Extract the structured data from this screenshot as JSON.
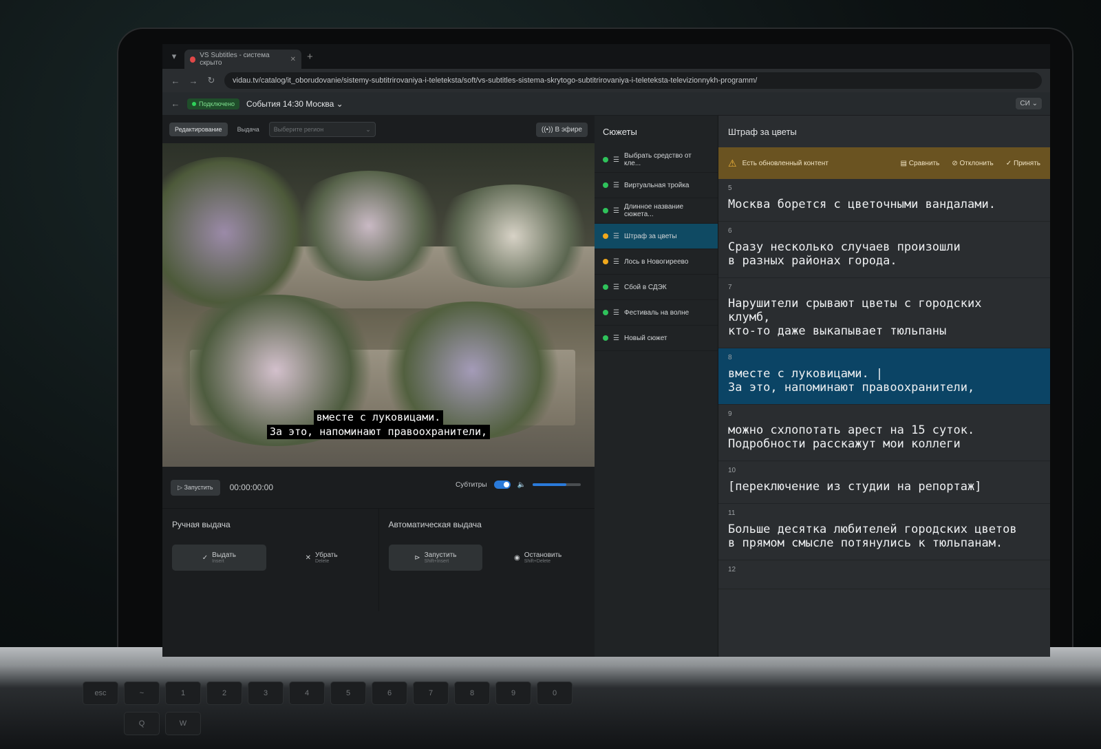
{
  "browser": {
    "tab_title": "VS Subtitles - система скрыто",
    "url": "vidau.tv/catalog/it_oborudovanie/sistemy-subtitrirovaniya-i-teleteksta/soft/vs-subtitles-sistema-skrytogo-subtitrirovaniya-i-teleteksta-televizionnykh-programm/"
  },
  "header": {
    "status_badge": "Подключено",
    "event_title": "События 14:30 Москва",
    "user_initials": "СИ"
  },
  "toolbar": {
    "mode_edit": "Редактирование",
    "mode_issue": "Выдача",
    "region_placeholder": "Выберите регион",
    "on_air": "В эфире"
  },
  "player": {
    "caption_line1": "вместе с луковицами.",
    "caption_line2": "За это, напоминают правоохранители,",
    "play_label": "Запустить",
    "timecode": "00:00:00:00",
    "subtitles_label": "Субтитры",
    "volume_level": 0.7
  },
  "manual": {
    "title": "Ручная выдача",
    "issue_label": "Выдать",
    "issue_hint": "Insert",
    "remove_label": "Убрать",
    "remove_hint": "Delete"
  },
  "auto": {
    "title": "Автоматическая выдача",
    "start_label": "Запустить",
    "start_hint": "Shift+Insert",
    "stop_label": "Остановить",
    "stop_hint": "Shift+Delete"
  },
  "stories": {
    "title": "Сюжеты",
    "items": [
      {
        "label": "Выбрать средство от кле...",
        "status_color": "#2fc25b"
      },
      {
        "label": "Виртуальная тройка",
        "status_color": "#2fc25b"
      },
      {
        "label": "Длинное название сюжета...",
        "status_color": "#2fc25b"
      },
      {
        "label": "Штраф за цветы",
        "status_color": "#f0a81c"
      },
      {
        "label": "Лось в Новогиреево",
        "status_color": "#f0a81c"
      },
      {
        "label": "Сбой в СДЭК",
        "status_color": "#2fc25b"
      },
      {
        "label": "Фестиваль на волне",
        "status_color": "#2fc25b"
      },
      {
        "label": "Новый сюжет",
        "status_color": "#2fc25b"
      }
    ]
  },
  "editor": {
    "title": "Штраф за цветы",
    "notice": "Есть обновленный контент",
    "compare": "Сравнить",
    "reject": "Отклонить",
    "accept": "Принять",
    "cues": [
      {
        "num": "5",
        "text": "Москва борется с цветочными вандалами."
      },
      {
        "num": "6",
        "text": "Сразу несколько случаев произошли\nв разных районах города."
      },
      {
        "num": "7",
        "text": "Нарушители срывают цветы с городских\nклумб,\nкто-то даже выкапывает тюльпаны"
      },
      {
        "num": "8",
        "text": "вместе с луковицами. |\nЗа это, напоминают правоохранители,"
      },
      {
        "num": "9",
        "text": "можно схлопотать арест на 15 суток.\nПодробности расскажут мои коллеги"
      },
      {
        "num": "10",
        "text": "[переключение из студии на репортаж]"
      },
      {
        "num": "11",
        "text": "Больше десятка любителей городских цветов\nв прямом смысле потянулись к тюльпанам."
      },
      {
        "num": "12",
        "text": ""
      }
    ]
  },
  "keyboard": [
    "esc",
    "~",
    "1",
    "2",
    "3",
    "4",
    "5",
    "6",
    "7",
    "8",
    "9",
    "0",
    "Q",
    "W"
  ]
}
